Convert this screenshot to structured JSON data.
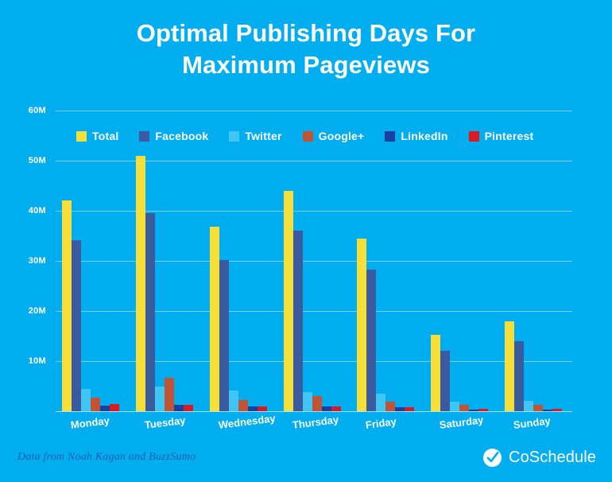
{
  "background_color": "#00AEEF",
  "title": {
    "line1": "Optimal Publishing Days For",
    "line2": "Maximum Pageviews"
  },
  "footer": {
    "source_note": "Data from Noah Kagan and BuzzSumo",
    "brand_name": "CoSchedule",
    "brand_mark_icon": "check-circle-icon"
  },
  "chart_data": {
    "type": "bar",
    "title": "Optimal Publishing Days For Maximum Pageviews",
    "xlabel": "",
    "ylabel": "",
    "ylim": [
      0,
      60
    ],
    "unit": "M",
    "grid": true,
    "legend_position": "top-left",
    "y_ticks": [
      "60M",
      "50M",
      "40M",
      "30M",
      "20M",
      "10M"
    ],
    "y_tick_values": [
      60,
      50,
      40,
      30,
      20,
      10
    ],
    "categories": [
      "Monday",
      "Tuesday",
      "Wednesday",
      "Thursday",
      "Friday",
      "Saturday",
      "Sunday"
    ],
    "series": [
      {
        "name": "Total",
        "color": "#F7DF3A",
        "values": [
          42.0,
          51.0,
          36.8,
          44.0,
          34.5,
          15.3,
          17.9
        ]
      },
      {
        "name": "Facebook",
        "color": "#3A5BA0",
        "values": [
          34.2,
          39.5,
          30.2,
          36.0,
          28.3,
          12.0,
          13.9
        ]
      },
      {
        "name": "Twitter",
        "color": "#3FC6F4",
        "values": [
          4.5,
          4.9,
          4.1,
          3.8,
          3.5,
          1.9,
          2.1
        ]
      },
      {
        "name": "Google+",
        "color": "#C25436",
        "values": [
          2.7,
          6.6,
          2.3,
          3.0,
          1.9,
          1.2,
          1.3
        ]
      },
      {
        "name": "LinkedIn",
        "color": "#1A3FA0",
        "values": [
          1.1,
          1.2,
          0.9,
          1.0,
          0.8,
          0.3,
          0.3
        ]
      },
      {
        "name": "Pinterest",
        "color": "#D91A22",
        "values": [
          1.4,
          1.2,
          1.0,
          1.0,
          0.8,
          0.5,
          0.4
        ]
      }
    ]
  }
}
